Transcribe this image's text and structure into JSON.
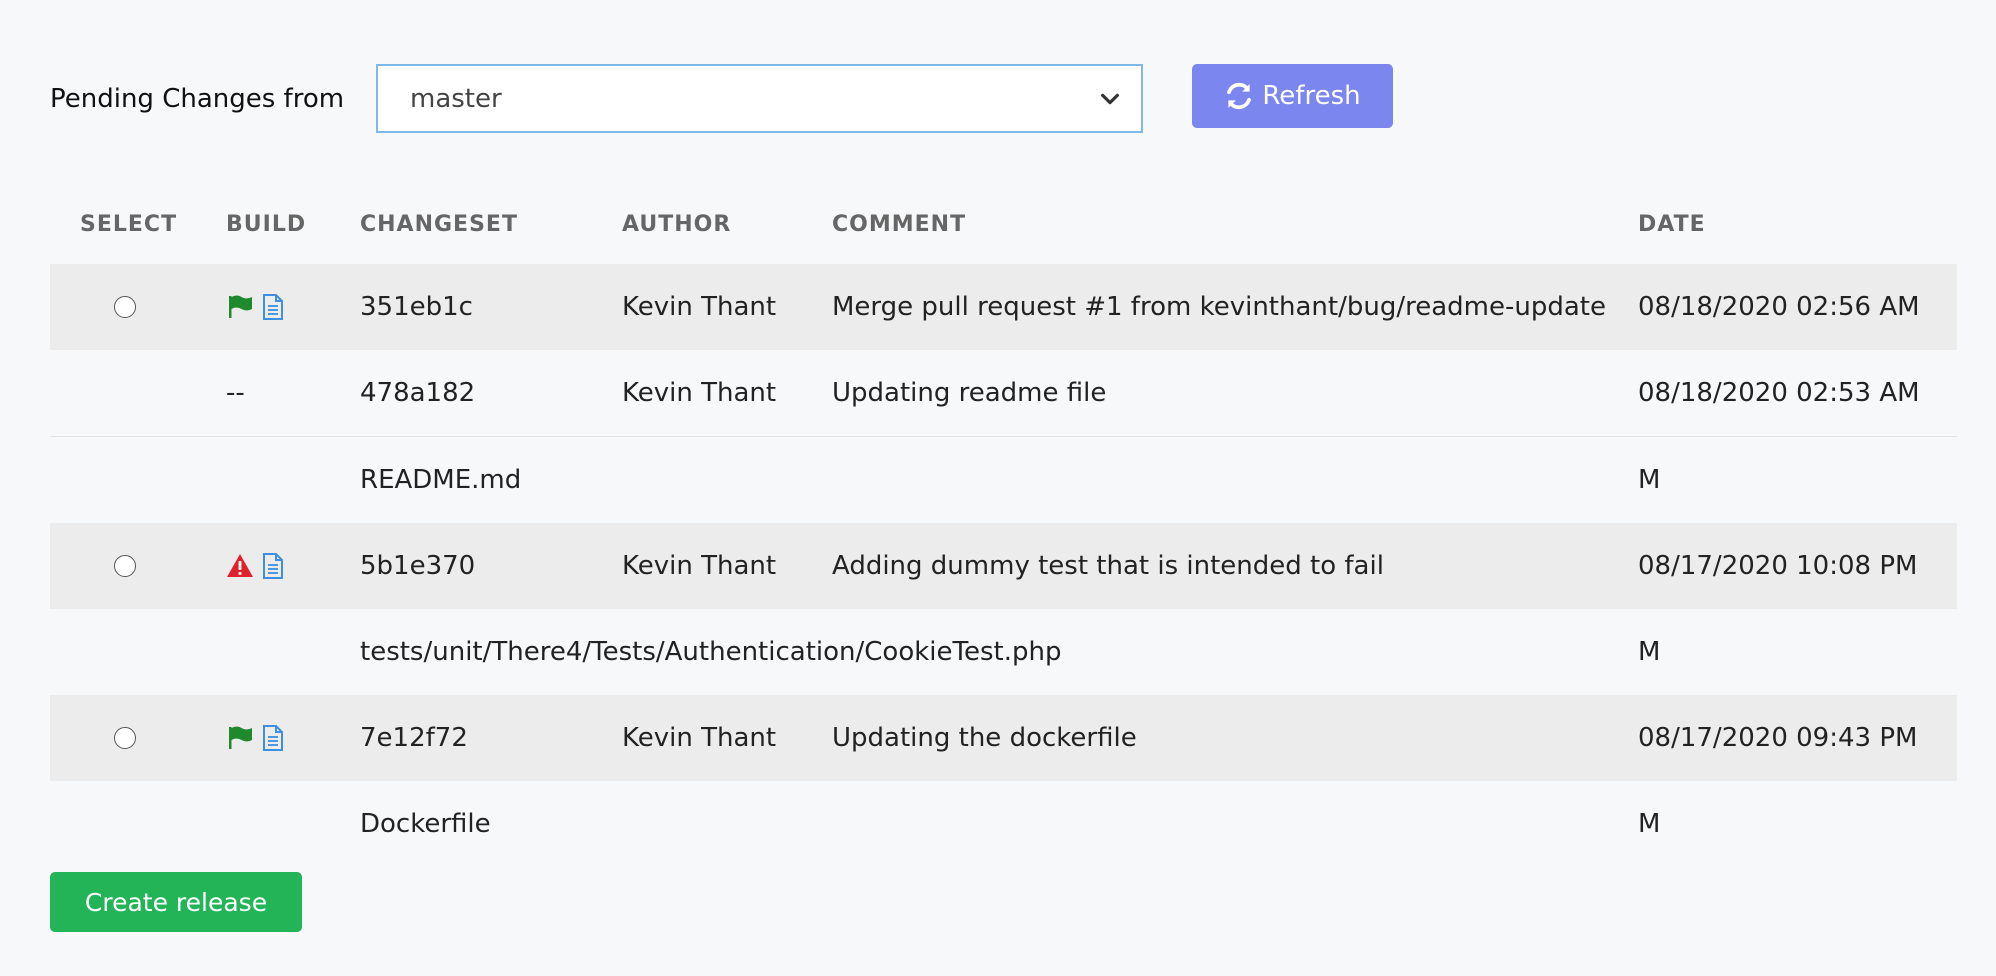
{
  "toolbar": {
    "label": "Pending Changes from",
    "branch_value": "master",
    "refresh_label": "Refresh"
  },
  "table": {
    "headers": {
      "select": "SELECT",
      "build": "BUILD",
      "changeset": "CHANGESET",
      "author": "AUTHOR",
      "comment": "COMMENT",
      "date": "DATE"
    },
    "rows": [
      {
        "type": "commit",
        "build_status": "flag-icon",
        "changeset": "351eb1c",
        "author": "Kevin Thant",
        "comment": "Merge pull request #1 from kevinthant/bug/readme-update",
        "date": "08/18/2020 02:56 AM"
      },
      {
        "type": "commit-sub",
        "build_text": "--",
        "changeset": "478a182",
        "author": "Kevin Thant",
        "comment": "Updating readme file",
        "date": "08/18/2020 02:53 AM"
      },
      {
        "type": "file",
        "path": "README.md",
        "change": "M"
      },
      {
        "type": "commit",
        "build_status": "warning-icon",
        "changeset": "5b1e370",
        "author": "Kevin Thant",
        "comment": "Adding dummy test that is intended to fail",
        "date": "08/17/2020 10:08 PM"
      },
      {
        "type": "file",
        "path": "tests/unit/There4/Tests/Authentication/CookieTest.php",
        "change": "M"
      },
      {
        "type": "commit",
        "build_status": "flag-icon",
        "changeset": "7e12f72",
        "author": "Kevin Thant",
        "comment": "Updating the dockerfile",
        "date": "08/17/2020 09:43 PM"
      },
      {
        "type": "file",
        "path": "Dockerfile",
        "change": "M"
      }
    ]
  },
  "footer": {
    "create_release_label": "Create release"
  },
  "colors": {
    "refresh_button": "#7b86ef",
    "create_button": "#23b457",
    "flag": "#1e8a2b",
    "warning": "#e0202a",
    "doc": "#3d8fe0"
  }
}
